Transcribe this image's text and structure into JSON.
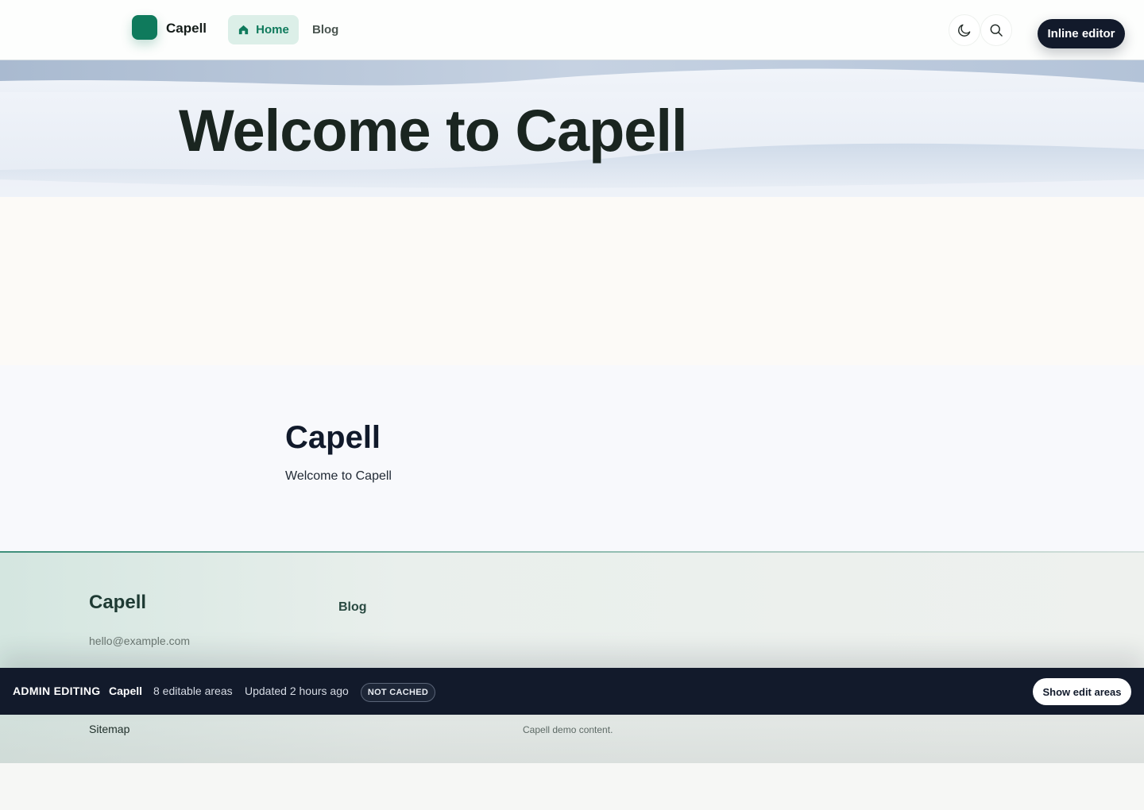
{
  "header": {
    "brand": "Capell",
    "nav": [
      {
        "label": "Home",
        "active": true
      },
      {
        "label": "Blog",
        "active": false
      }
    ],
    "editor_button": "Inline editor",
    "icons": [
      "moon-icon",
      "search-icon",
      "home-icon"
    ]
  },
  "hero": {
    "title": "Welcome to Capell"
  },
  "content": {
    "title": "Capell",
    "text": "Welcome to Capell"
  },
  "footer": {
    "brand": "Capell",
    "email": "hello@example.com",
    "links": [
      "Blog"
    ],
    "sitemap": "Sitemap",
    "copy": "Capell demo content."
  },
  "admin_bar": {
    "label": "ADMIN EDITING",
    "site": "Capell",
    "areas": "8 editable areas",
    "updated": "Updated 2 hours ago",
    "badge": "NOT CACHED",
    "show_button": "Show edit areas"
  },
  "colors": {
    "accent": "#0f7a5c",
    "dark": "#121a2b",
    "active_nav_bg": "#dcefe8"
  }
}
